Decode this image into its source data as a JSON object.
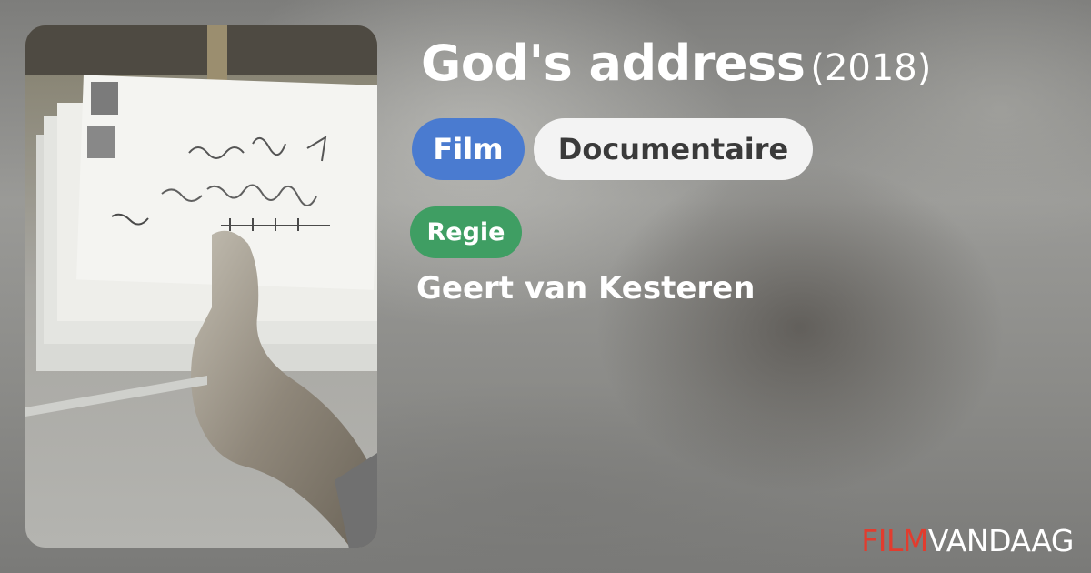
{
  "movie": {
    "title": "God's address",
    "year": "(2018)",
    "poster_alt": "Poster: hand holding a stack of handwritten envelopes"
  },
  "tags": {
    "type": "Film",
    "genre": "Documentaire"
  },
  "credits": {
    "role": "Regie",
    "director": "Geert van Kesteren"
  },
  "brand": {
    "part1": "FILM",
    "part2": "VANDAAG"
  },
  "colors": {
    "film_chip": "#4a7bd0",
    "genre_chip": "#f3f3f3",
    "role_chip": "#3f9e63",
    "logo_red": "#e23c2e"
  }
}
